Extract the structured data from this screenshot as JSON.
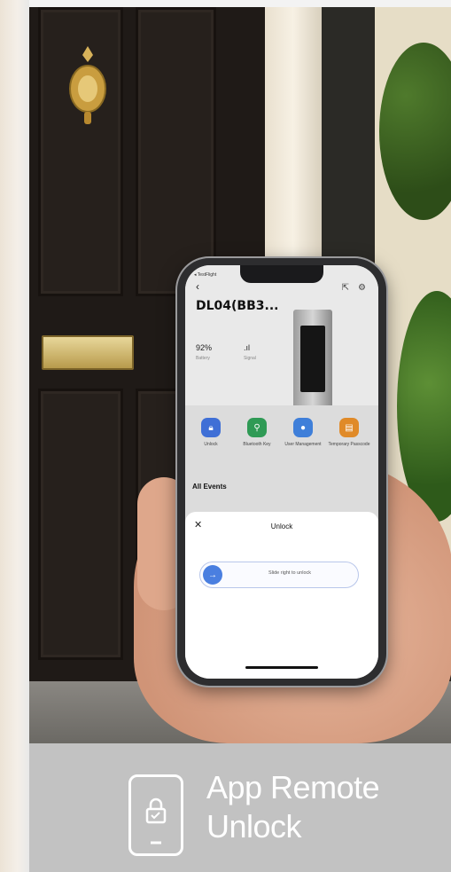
{
  "phone_app": {
    "status_text": "◂ TestFlight",
    "device_name": "DL04(BB3...",
    "battery_value": "92%",
    "battery_label": "Battery",
    "signal_label": "Signal",
    "quick_actions": [
      {
        "label": "Unlock",
        "color": "#3f6fd6",
        "icon": "lock-icon"
      },
      {
        "label": "Bluetooth Key",
        "color": "#2f9a55",
        "icon": "key-icon"
      },
      {
        "label": "User Management",
        "color": "#3f7fd9",
        "icon": "user-icon"
      },
      {
        "label": "Temporary Passcode",
        "color": "#e08a28",
        "icon": "passcode-icon"
      }
    ],
    "events_title": "All Events",
    "modal": {
      "title": "Unlock",
      "close_glyph": "✕",
      "slider_label": "Slide right to unlock",
      "slider_glyph": "→"
    }
  },
  "caption": {
    "title": "App Remote Unlock",
    "background": "#c2c2c2",
    "text_color": "#ffffff"
  }
}
